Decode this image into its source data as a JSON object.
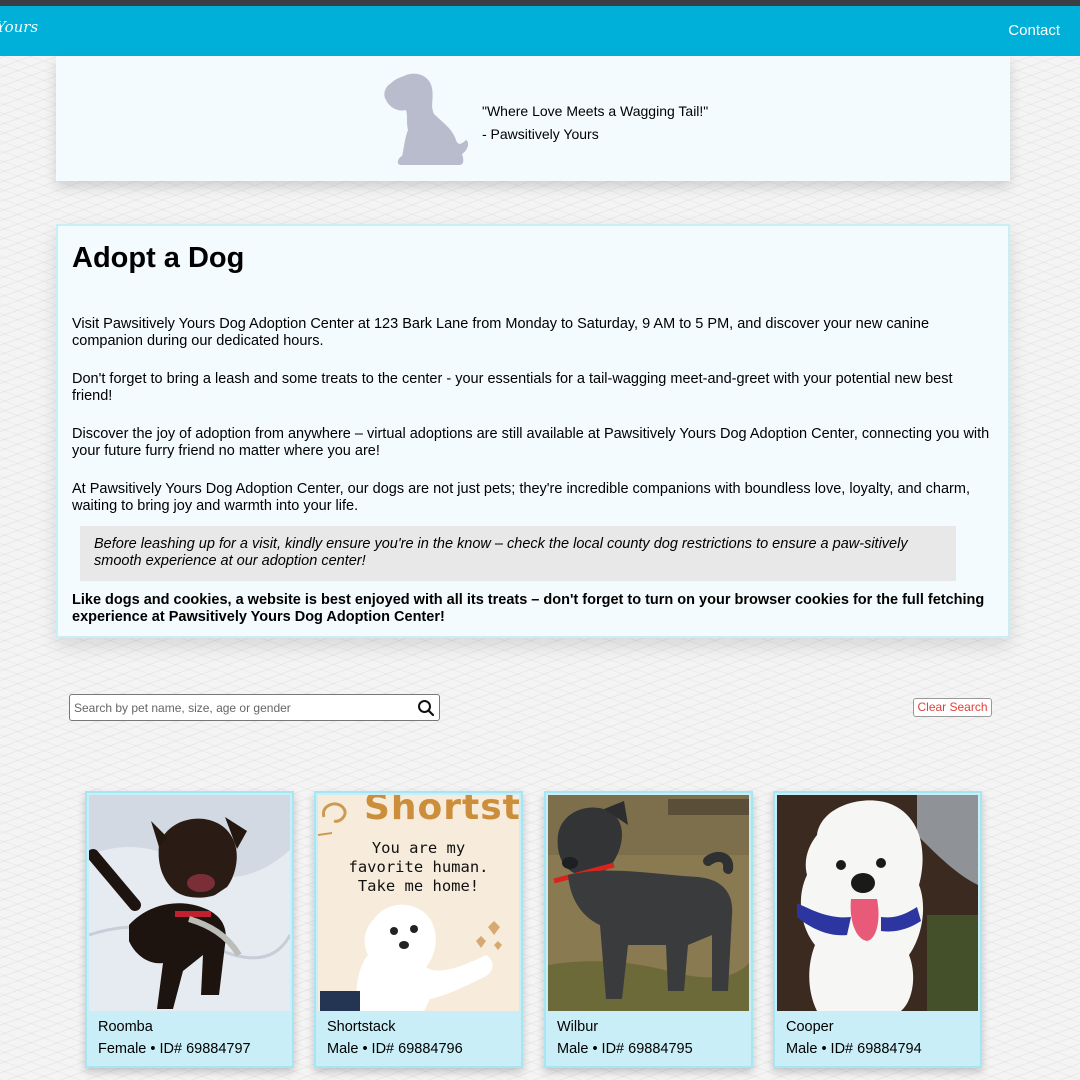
{
  "nav": {
    "brand_fragment": "Yours",
    "contact_label": "Contact"
  },
  "hero": {
    "quote": "\"Where Love Meets a Wagging Tail!\"",
    "attribution": "- Pawsitively Yours"
  },
  "info": {
    "title": "Adopt a Dog",
    "paragraphs": [
      "Visit Pawsitively Yours Dog Adoption Center at 123 Bark Lane from Monday to Saturday, 9 AM to 5 PM, and discover your new canine companion during our dedicated hours.",
      "Don't forget to bring a leash and some treats to the center - your essentials for a tail-wagging meet-and-greet with your potential new best friend!",
      "Discover the joy of adoption from anywhere – virtual adoptions are still available at Pawsitively Yours Dog Adoption Center, connecting you with your future furry friend no matter where you are!",
      "At Pawsitively Yours Dog Adoption Center, our dogs are not just pets; they're incredible companions with boundless love, loyalty, and charm, waiting to bring joy and warmth into your life."
    ],
    "note": "Before leashing up for a visit, kindly ensure you're in the know – check the local county dog restrictions to ensure a paw-sitively smooth experience at our adoption center!",
    "cookie_notice": "Like dogs and cookies, a website is best enjoyed with all its treats – don't forget to turn on your browser cookies for the full fetching experience at Pawsitively Yours Dog Adoption Center!"
  },
  "search": {
    "placeholder": "Search by pet name, size, age or gender",
    "clear_label": "Clear Search"
  },
  "dogs": [
    {
      "name": "Roomba",
      "meta": "Female • ID# 69884797"
    },
    {
      "name": "Shortstack",
      "meta": "Male • ID# 69884796",
      "photo_text": {
        "title": "Shortsta",
        "line1": "You are my",
        "line2": "favorite human.",
        "line3": "Take me home!"
      }
    },
    {
      "name": "Wilbur",
      "meta": "Male • ID# 69884795"
    },
    {
      "name": "Cooper",
      "meta": "Male • ID# 69884794"
    }
  ],
  "colors": {
    "nav": "#00b0d8",
    "card": "#c9eef7",
    "clear_text": "#e0403a"
  }
}
